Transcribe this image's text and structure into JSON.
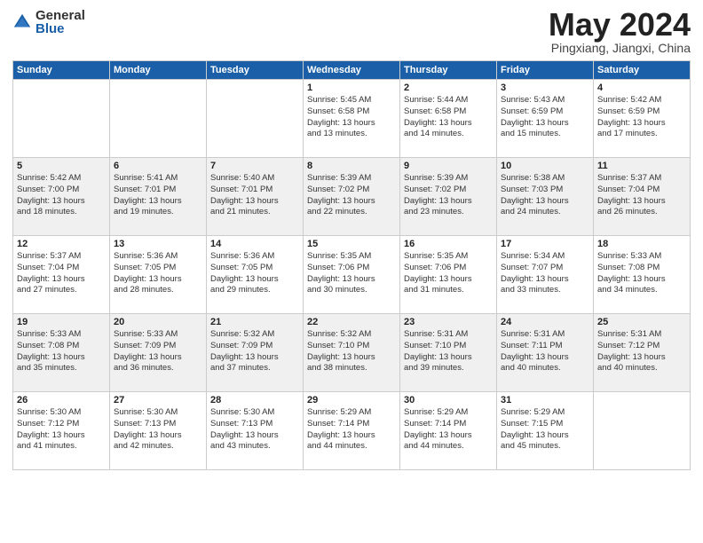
{
  "header": {
    "logo_general": "General",
    "logo_blue": "Blue",
    "title": "May 2024",
    "location": "Pingxiang, Jiangxi, China"
  },
  "days_of_week": [
    "Sunday",
    "Monday",
    "Tuesday",
    "Wednesday",
    "Thursday",
    "Friday",
    "Saturday"
  ],
  "weeks": [
    [
      {
        "day": "",
        "info": ""
      },
      {
        "day": "",
        "info": ""
      },
      {
        "day": "",
        "info": ""
      },
      {
        "day": "1",
        "info": "Sunrise: 5:45 AM\nSunset: 6:58 PM\nDaylight: 13 hours\nand 13 minutes."
      },
      {
        "day": "2",
        "info": "Sunrise: 5:44 AM\nSunset: 6:58 PM\nDaylight: 13 hours\nand 14 minutes."
      },
      {
        "day": "3",
        "info": "Sunrise: 5:43 AM\nSunset: 6:59 PM\nDaylight: 13 hours\nand 15 minutes."
      },
      {
        "day": "4",
        "info": "Sunrise: 5:42 AM\nSunset: 6:59 PM\nDaylight: 13 hours\nand 17 minutes."
      }
    ],
    [
      {
        "day": "5",
        "info": "Sunrise: 5:42 AM\nSunset: 7:00 PM\nDaylight: 13 hours\nand 18 minutes."
      },
      {
        "day": "6",
        "info": "Sunrise: 5:41 AM\nSunset: 7:01 PM\nDaylight: 13 hours\nand 19 minutes."
      },
      {
        "day": "7",
        "info": "Sunrise: 5:40 AM\nSunset: 7:01 PM\nDaylight: 13 hours\nand 21 minutes."
      },
      {
        "day": "8",
        "info": "Sunrise: 5:39 AM\nSunset: 7:02 PM\nDaylight: 13 hours\nand 22 minutes."
      },
      {
        "day": "9",
        "info": "Sunrise: 5:39 AM\nSunset: 7:02 PM\nDaylight: 13 hours\nand 23 minutes."
      },
      {
        "day": "10",
        "info": "Sunrise: 5:38 AM\nSunset: 7:03 PM\nDaylight: 13 hours\nand 24 minutes."
      },
      {
        "day": "11",
        "info": "Sunrise: 5:37 AM\nSunset: 7:04 PM\nDaylight: 13 hours\nand 26 minutes."
      }
    ],
    [
      {
        "day": "12",
        "info": "Sunrise: 5:37 AM\nSunset: 7:04 PM\nDaylight: 13 hours\nand 27 minutes."
      },
      {
        "day": "13",
        "info": "Sunrise: 5:36 AM\nSunset: 7:05 PM\nDaylight: 13 hours\nand 28 minutes."
      },
      {
        "day": "14",
        "info": "Sunrise: 5:36 AM\nSunset: 7:05 PM\nDaylight: 13 hours\nand 29 minutes."
      },
      {
        "day": "15",
        "info": "Sunrise: 5:35 AM\nSunset: 7:06 PM\nDaylight: 13 hours\nand 30 minutes."
      },
      {
        "day": "16",
        "info": "Sunrise: 5:35 AM\nSunset: 7:06 PM\nDaylight: 13 hours\nand 31 minutes."
      },
      {
        "day": "17",
        "info": "Sunrise: 5:34 AM\nSunset: 7:07 PM\nDaylight: 13 hours\nand 33 minutes."
      },
      {
        "day": "18",
        "info": "Sunrise: 5:33 AM\nSunset: 7:08 PM\nDaylight: 13 hours\nand 34 minutes."
      }
    ],
    [
      {
        "day": "19",
        "info": "Sunrise: 5:33 AM\nSunset: 7:08 PM\nDaylight: 13 hours\nand 35 minutes."
      },
      {
        "day": "20",
        "info": "Sunrise: 5:33 AM\nSunset: 7:09 PM\nDaylight: 13 hours\nand 36 minutes."
      },
      {
        "day": "21",
        "info": "Sunrise: 5:32 AM\nSunset: 7:09 PM\nDaylight: 13 hours\nand 37 minutes."
      },
      {
        "day": "22",
        "info": "Sunrise: 5:32 AM\nSunset: 7:10 PM\nDaylight: 13 hours\nand 38 minutes."
      },
      {
        "day": "23",
        "info": "Sunrise: 5:31 AM\nSunset: 7:10 PM\nDaylight: 13 hours\nand 39 minutes."
      },
      {
        "day": "24",
        "info": "Sunrise: 5:31 AM\nSunset: 7:11 PM\nDaylight: 13 hours\nand 40 minutes."
      },
      {
        "day": "25",
        "info": "Sunrise: 5:31 AM\nSunset: 7:12 PM\nDaylight: 13 hours\nand 40 minutes."
      }
    ],
    [
      {
        "day": "26",
        "info": "Sunrise: 5:30 AM\nSunset: 7:12 PM\nDaylight: 13 hours\nand 41 minutes."
      },
      {
        "day": "27",
        "info": "Sunrise: 5:30 AM\nSunset: 7:13 PM\nDaylight: 13 hours\nand 42 minutes."
      },
      {
        "day": "28",
        "info": "Sunrise: 5:30 AM\nSunset: 7:13 PM\nDaylight: 13 hours\nand 43 minutes."
      },
      {
        "day": "29",
        "info": "Sunrise: 5:29 AM\nSunset: 7:14 PM\nDaylight: 13 hours\nand 44 minutes."
      },
      {
        "day": "30",
        "info": "Sunrise: 5:29 AM\nSunset: 7:14 PM\nDaylight: 13 hours\nand 44 minutes."
      },
      {
        "day": "31",
        "info": "Sunrise: 5:29 AM\nSunset: 7:15 PM\nDaylight: 13 hours\nand 45 minutes."
      },
      {
        "day": "",
        "info": ""
      }
    ]
  ]
}
